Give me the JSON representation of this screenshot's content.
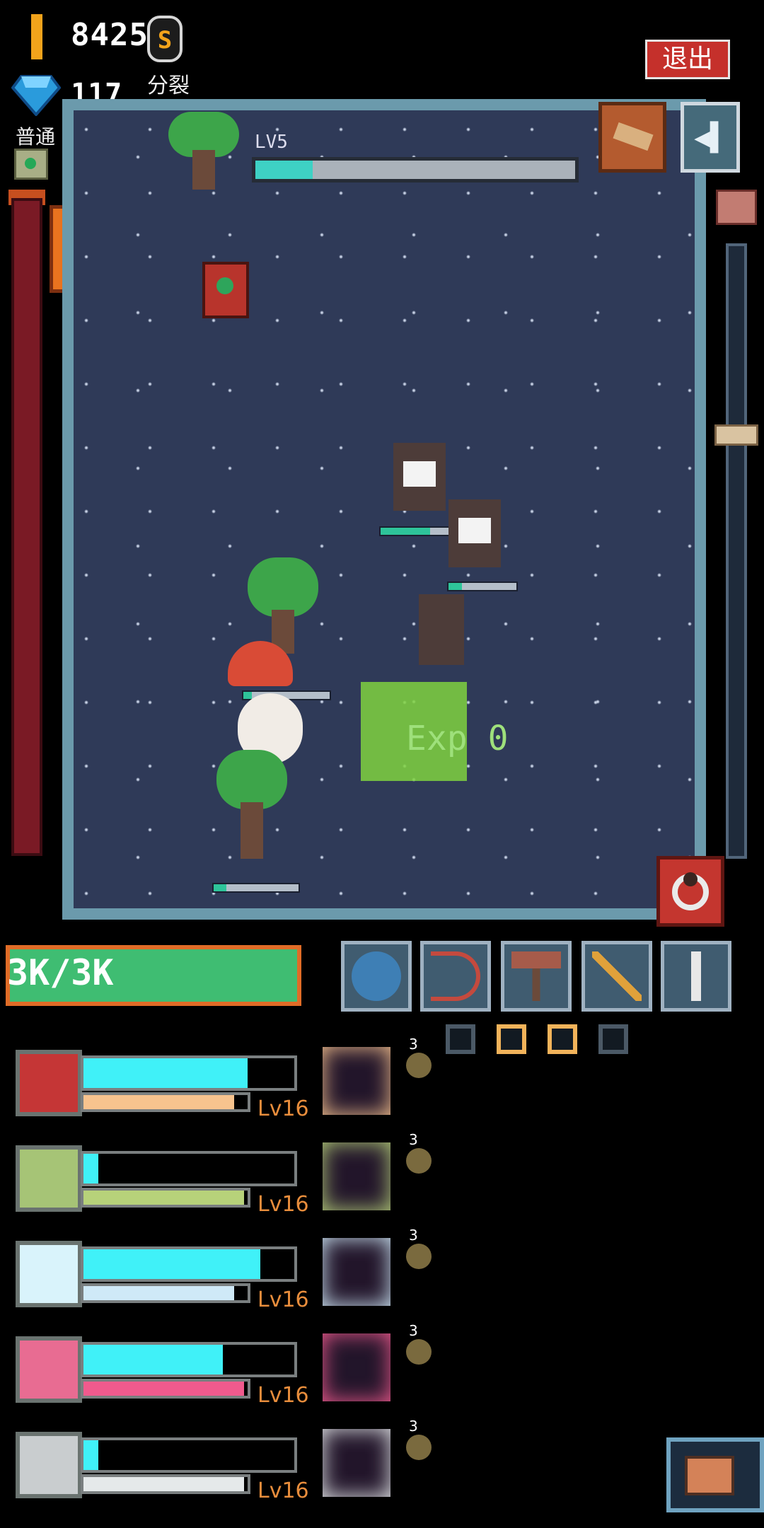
{
  "top": {
    "gold": "8425",
    "coin_symbol": "S",
    "split_label": "分裂",
    "gems": "117",
    "difficulty": "普通",
    "exit_label": "退出"
  },
  "arena": {
    "level_label": "LV5",
    "level_progress": 0.18,
    "exp_popup": "Exp 0",
    "back_glyph": "◀▌"
  },
  "player": {
    "hp_text": "3K/3K"
  },
  "slot_dots": [
    false,
    true,
    true,
    false
  ],
  "heroes": [
    {
      "name": "shield",
      "level": "Lv16",
      "main": 0.78,
      "sub": 0.92,
      "sub_color": "#f7c38e",
      "icon_color": "#c53636",
      "count": "3"
    },
    {
      "name": "bow",
      "level": "Lv16",
      "main": 0.07,
      "sub": 0.98,
      "sub_color": "#b7d27a",
      "icon_color": "#a6c476",
      "count": "3"
    },
    {
      "name": "staff",
      "level": "Lv16",
      "main": 0.84,
      "sub": 0.92,
      "sub_color": "#cfe9f7",
      "icon_color": "#d9f3fb",
      "count": "3"
    },
    {
      "name": "wand",
      "level": "Lv16",
      "main": 0.66,
      "sub": 0.98,
      "sub_color": "#f05a8d",
      "icon_color": "#e86c92",
      "count": "3"
    },
    {
      "name": "sword",
      "level": "Lv16",
      "main": 0.07,
      "sub": 0.98,
      "sub_color": "#e5e9ea",
      "icon_color": "#c9cdcf",
      "count": "3"
    }
  ]
}
